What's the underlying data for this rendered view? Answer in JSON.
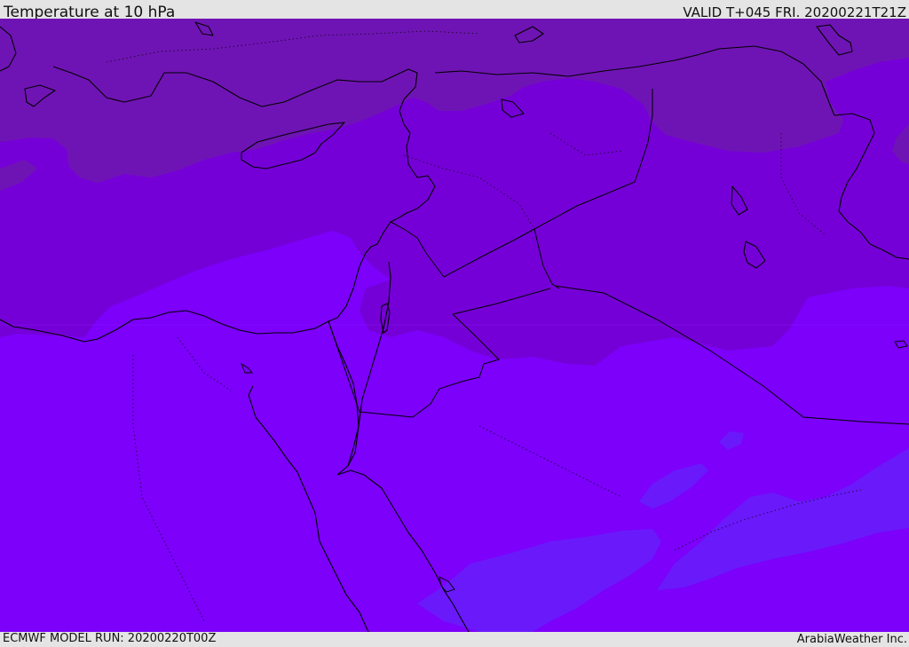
{
  "header": {
    "title": "Temperature at 10 hPa",
    "valid_time": "VALID T+045 FRI. 20200221T21Z"
  },
  "footer": {
    "model_run": "ECMWF MODEL RUN: 20200220T00Z",
    "credit": "ArabiaWeather Inc."
  },
  "colors": {
    "band_coldest": "#6f14b4",
    "band_cold": "#7500d7",
    "band_base": "#7c00fa",
    "band_warm": "#6a19fb",
    "coastline": "#000000",
    "page_background": "#e4e4e4"
  }
}
